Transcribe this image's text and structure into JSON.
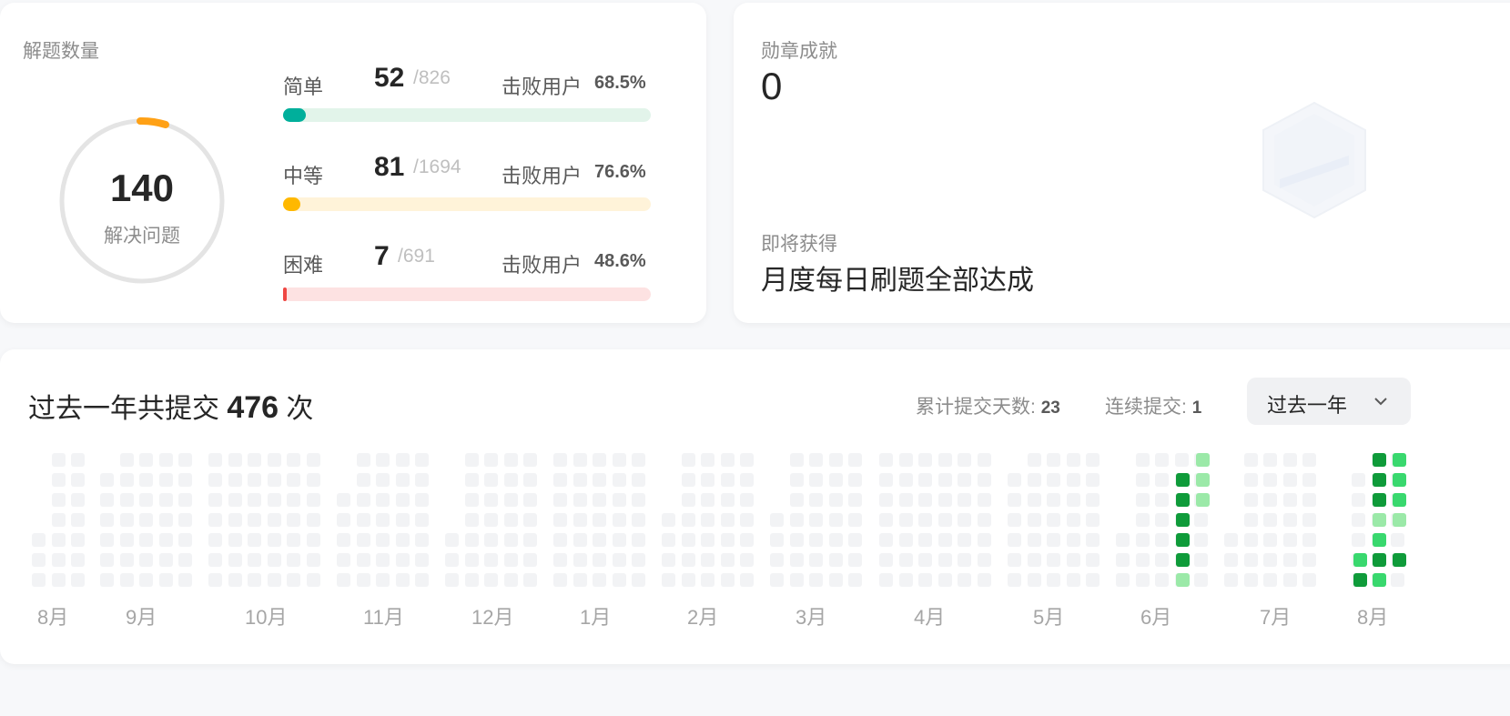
{
  "solved": {
    "title": "解题数量",
    "total": "140",
    "total_label": "解决问题",
    "rows": [
      {
        "label": "简单",
        "count": "52",
        "total": "/826",
        "beat_label": "击败用户",
        "beat": "68.5%",
        "progress": 0.063,
        "track_color": "#e2f4ea",
        "fill_color": "#00af9b"
      },
      {
        "label": "中等",
        "count": "81",
        "total": "/1694",
        "beat_label": "击败用户",
        "beat": "76.6%",
        "progress": 0.048,
        "track_color": "#fff3d9",
        "fill_color": "#ffb800"
      },
      {
        "label": "困难",
        "count": "7",
        "total": "/691",
        "beat_label": "击败用户",
        "beat": "48.6%",
        "progress": 0.01,
        "track_color": "#fde2e2",
        "fill_color": "#ef4743"
      }
    ]
  },
  "badges": {
    "title": "勋章成就",
    "count": "0",
    "upcoming_label": "即将获得",
    "upcoming_name": "月度每日刷题全部达成"
  },
  "heatmap": {
    "title_prefix": "过去一年共提交",
    "total": "476",
    "title_suffix": "次",
    "cum_days_label": "累计提交天数:",
    "cum_days": "23",
    "streak_label": "连续提交:",
    "streak": "1",
    "range_selected": "过去一年",
    "months": [
      "8月",
      "9月",
      "10月",
      "11月",
      "12月",
      "1月",
      "2月",
      "3月",
      "4月",
      "5月",
      "6月",
      "7月",
      "8月"
    ],
    "colors": {
      "empty": "#f2f3f5",
      "light": "#9be9a8",
      "medium": "#39d86e",
      "dark": "#0f9b3a"
    }
  }
}
